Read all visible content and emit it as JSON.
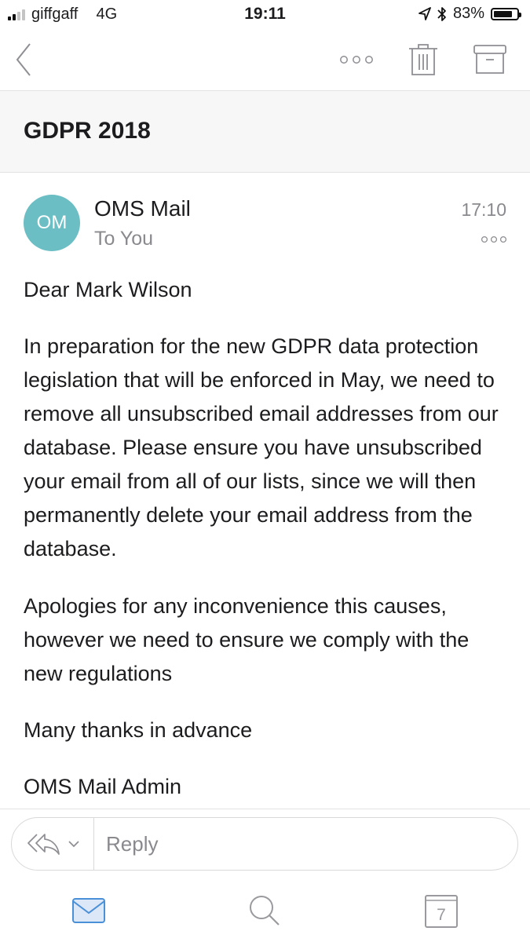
{
  "status_bar": {
    "carrier": "giffgaff",
    "network": "4G",
    "time": "19:11",
    "battery_percent": "83%",
    "battery_level": 0.83,
    "signal_bars": 2,
    "icons": [
      "signal-icon",
      "location-arrow-icon",
      "bluetooth-icon",
      "battery-icon"
    ]
  },
  "toolbar": {
    "icons": [
      "back-chevron-icon",
      "more-options-icon",
      "trash-icon",
      "archive-icon"
    ]
  },
  "email": {
    "subject": "GDPR 2018",
    "avatar_initials": "OM",
    "avatar_color": "#6bbec3",
    "sender": "OMS Mail",
    "recipient": "To You",
    "time": "17:10",
    "body": {
      "greeting": "Dear Mark Wilson",
      "paragraph1": "In preparation for the new GDPR data protection legislation that will be enforced in May, we need to remove all unsubscribed email addresses from our database. Please ensure you have unsubscribed your email from all of our lists, since we will then permanently delete your email address from the database.",
      "paragraph2": "Apologies for any inconvenience this causes, however we need to ensure we comply with the new regulations",
      "thanks": "Many thanks in advance",
      "signature": "OMS Mail Admin"
    }
  },
  "reply": {
    "placeholder": "Reply",
    "icons": [
      "reply-all-icon",
      "chevron-down-icon"
    ]
  },
  "tab_bar": {
    "calendar_day": "7",
    "active_color": "#4a90d9",
    "inactive_color": "#9a9a9e",
    "icons": [
      "mail-icon",
      "search-icon",
      "calendar-icon"
    ]
  }
}
